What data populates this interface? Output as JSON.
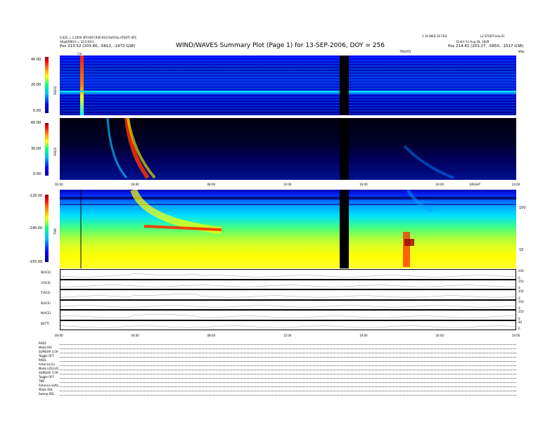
{
  "header": {
    "title": "WIND/WAVES Summary Plot (Page 1) for 13-SEP-2006, DOY = 256",
    "left_line1": "0.625 = 3.2000 SPC0SP [R00:001(%0%%)-ATEDT] SPC",
    "left_line2": "AE@ERB0 0 = 10:0:00:1",
    "left_line3": "Pos 213.52 (203.80, -5812, -1472 GSE)",
    "right_line1": "1.10 WED 20 FD3",
    "right_line1b": "L2 STODT:edu.01",
    "right_line2": "D:ALY: Fri Aug 28, 2009",
    "right_line3": "Pos 214.41 (203.27, -5850, -1517 GSE)",
    "cal_label": "Cal",
    "freq_unit_label": "TRISATS",
    "mhz": "MHz"
  },
  "panels": {
    "rad2": {
      "label": "RAD2",
      "ticks": [
        "40.00",
        "20.00",
        "0.00"
      ]
    },
    "rad1": {
      "label": "RAD1",
      "ticks": [
        "60.00",
        "30.00",
        "0.00"
      ]
    },
    "tnr": {
      "label": "TNR",
      "ticks": [
        "-125.00",
        "-140.00",
        "-155.00"
      ],
      "right_ticks": [
        "100",
        "10"
      ]
    },
    "time_ticks": [
      "00:00",
      "04:00",
      "08:00",
      "12:00",
      "16:00",
      "20:00",
      "24:00"
    ],
    "rad1_unit": "BRIGHT"
  },
  "line_plots": [
    {
      "label": "N(ACE)",
      "right": [
        "250",
        "0"
      ]
    },
    {
      "label": "V(ACE)",
      "right": [
        "250",
        "0"
      ]
    },
    {
      "label": "T(ACE)",
      "right": [
        "250",
        "0"
      ]
    },
    {
      "label": "B(ACE)",
      "right": [
        "250",
        "0"
      ]
    },
    {
      "label": "N(ACE)",
      "right": [
        "250",
        "0"
      ]
    },
    {
      "label": "Bt(TT)",
      "right": [
        "40",
        "0"
      ]
    }
  ],
  "footer": [
    "RAD2",
    "Mode  IRS",
    "SUMGAP 3.59",
    "Toggle  OFF",
    "RAD1",
    "Antenna  Ex",
    "Mode  LOGL(4)",
    "SUMGAP 3.59",
    "Toggle  OFF",
    "TNR",
    "Antenna  Softy",
    "Mode  ADL",
    "Sweep  ADL"
  ],
  "chart_data": {
    "type": "heatmap",
    "title": "WIND/WAVES Summary Plot (Page 1) for 13-SEP-2006, DOY = 256",
    "x": [
      "00:00",
      "04:00",
      "08:00",
      "12:00",
      "16:00",
      "20:00",
      "24:00"
    ],
    "xlim": [
      "00:00",
      "24:00"
    ],
    "series": [
      {
        "name": "RAD2",
        "ylim": [
          0.0,
          40.0
        ]
      },
      {
        "name": "RAD1",
        "ylim": [
          0.0,
          60.0
        ]
      },
      {
        "name": "TNR",
        "ylim": [
          -155.0,
          -125.0
        ]
      }
    ],
    "data_gap": [
      "13:45",
      "14:10"
    ],
    "grid": false
  }
}
